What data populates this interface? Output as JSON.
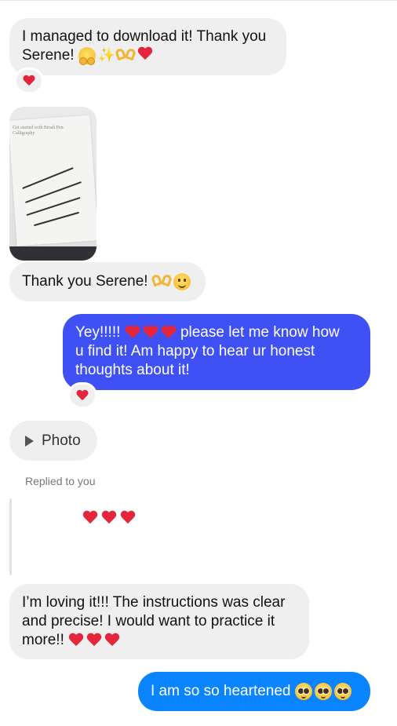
{
  "messages": {
    "m1_line1": "I managed to download it! Thank you",
    "m1_line2": "Serene!",
    "m1_reaction": "heart-icon",
    "image_caption": "Get started with Brush Pen Calligraphy",
    "m2_text": "Thank you Serene!",
    "m3_prefix": "Yey!!!!!",
    "m3_after_hearts": "please let me know how",
    "m3_line2": "u find it! Am happy to hear ur honest",
    "m3_line3": "thoughts about it!",
    "m3_reaction": "heart-icon",
    "photo_label": "Photo",
    "replied_label": "Replied to you",
    "m4_line1": "I’m loving it!!! The instructions was clear",
    "m4_line2": "and precise! I would want to practice it",
    "m4_line3": "more!!",
    "m5_text": "I am so so heartened"
  },
  "colors": {
    "incoming_bubble": "#efefef",
    "outgoing_purple": "#3f51f5",
    "outgoing_blue": "#0b84ff",
    "heart": "#e3263b"
  }
}
